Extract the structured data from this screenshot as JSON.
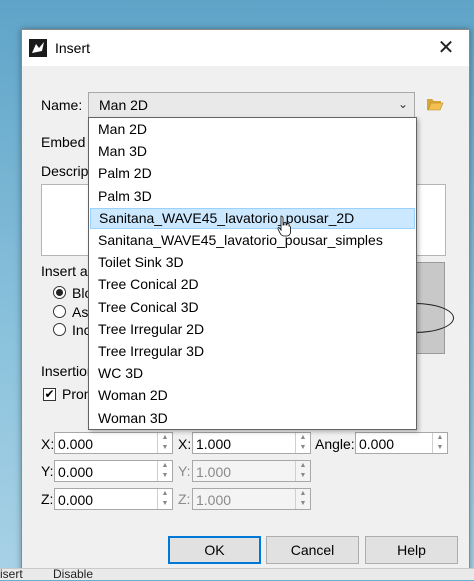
{
  "window": {
    "title": "Insert",
    "close_glyph": "✕"
  },
  "name_field": {
    "label": "Name:",
    "value": "Man 2D"
  },
  "labels": {
    "embed": "Embed",
    "description": "Descrip",
    "insert_as": "Insert as",
    "insertion": "Insertion",
    "radio1": "Blo",
    "radio2": "As",
    "radio3": "Inc",
    "prompt": "Pron"
  },
  "dropdown_items": [
    "Man 2D",
    "Man 3D",
    "Palm 2D",
    "Palm 3D",
    "Sanitana_WAVE45_lavatorio_pousar_2D",
    "Sanitana_WAVE45_lavatorio_pousar_simples",
    "Toilet Sink 3D",
    "Tree Conical 2D",
    "Tree Conical 3D",
    "Tree Irregular 2D",
    "Tree Irregular 3D",
    "WC 3D",
    "Woman 2D",
    "Woman 3D"
  ],
  "highlighted_item": "Sanitana_WAVE45_lavatorio_pousar_2D",
  "coords": {
    "x_label": "X:",
    "x_value": "0.000",
    "y_label": "Y:",
    "y_value": "0.000",
    "z_label": "Z:",
    "z_value": "0.000"
  },
  "scale": {
    "x_label": "X:",
    "x_value": "1.000",
    "y_label": "Y:",
    "y_value": "1.000",
    "z_label": "Z:",
    "z_value": "1.000"
  },
  "angle": {
    "label": "Angle:",
    "value": "0.000"
  },
  "buttons": {
    "ok": "OK",
    "cancel": "Cancel",
    "help": "Help"
  },
  "taskbar": {
    "left": "isert",
    "right": "Disable"
  }
}
